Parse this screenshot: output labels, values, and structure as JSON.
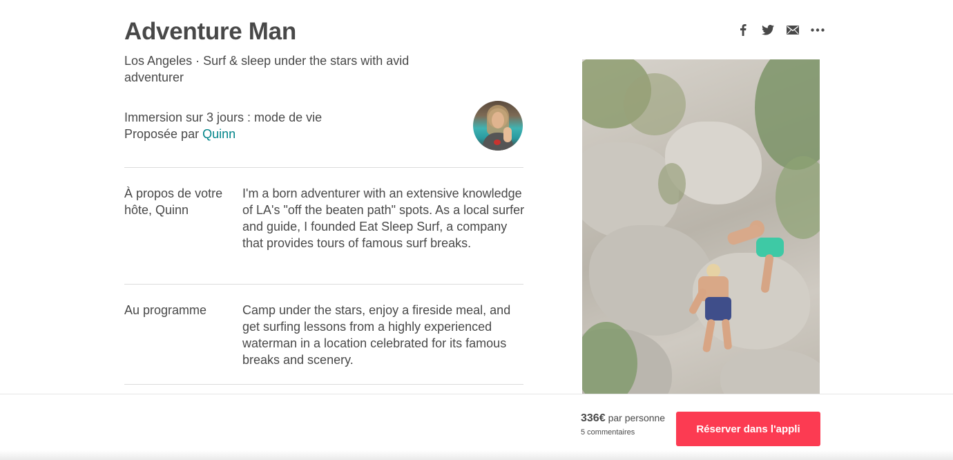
{
  "header": {
    "title": "Adventure Man",
    "subtitle": "Los Angeles · Surf & sleep under the stars with avid adventurer"
  },
  "share": {
    "icons": [
      "facebook-icon",
      "twitter-icon",
      "email-icon",
      "more-icon"
    ]
  },
  "experience": {
    "title": "Immersion sur 3 jours : mode de vie",
    "offered_by_prefix": "Proposée par ",
    "host_name": "Quinn"
  },
  "sections": [
    {
      "label": "À propos de votre hôte, Quinn",
      "text": "I'm a born adventurer with an extensive knowledge of LA's \"off the beaten path\" spots. As a local surfer and guide, I founded Eat Sleep Surf, a company that provides tours of famous surf breaks."
    },
    {
      "label": "Au programme",
      "text": "Camp under the stars, enjoy a fireside meal, and get surfing lessons from a highly experienced waterman in a location celebrated for its famous breaks and scenery."
    }
  ],
  "booking": {
    "price": "336€",
    "price_unit": "par personne",
    "reviews": "5 commentaires",
    "button_label": "Réserver dans l'appli"
  },
  "colors": {
    "accent": "#008489",
    "button": "#fc3b52",
    "text": "#484848",
    "divider": "#dbdbdb"
  }
}
